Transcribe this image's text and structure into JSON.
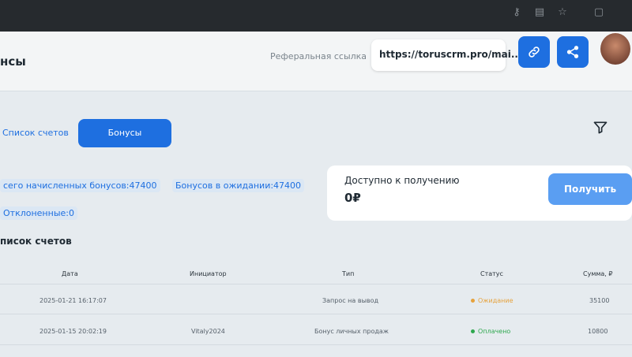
{
  "header": {
    "title": "нсы",
    "referral_label": "Реферальная ссылка",
    "referral_value": "https://toruscrm.pro/mai..."
  },
  "tabs": [
    {
      "label": "Список счетов"
    },
    {
      "label": "Бонусы"
    }
  ],
  "stats": {
    "total_bonuses": "сего начисленных бонусов:47400",
    "pending_bonuses": "Бонусов в ожидании:47400",
    "rejected": "Отклоненные:0"
  },
  "available": {
    "label": "Доступно к получению",
    "value": "0₽",
    "button_label": "Получить"
  },
  "section_title": "писок счетов",
  "table": {
    "headers": [
      "Дата",
      "Инициатор",
      "Тип",
      "Статус",
      "Сумма, ₽"
    ],
    "rows": [
      {
        "date": "2025-01-21 16:17:07",
        "initiator": "",
        "type": "Запрос на вывод",
        "status": "Ожидание",
        "status_color": "#e6a23c",
        "amount": "35100"
      },
      {
        "date": "2025-01-15 20:02:19",
        "initiator": "Vitaly2024",
        "type": "Бонус личных продаж",
        "status": "Оплачено",
        "status_color": "#2fa84f",
        "amount": "10800"
      }
    ]
  },
  "colors": {
    "accent": "#1e6fe0"
  }
}
